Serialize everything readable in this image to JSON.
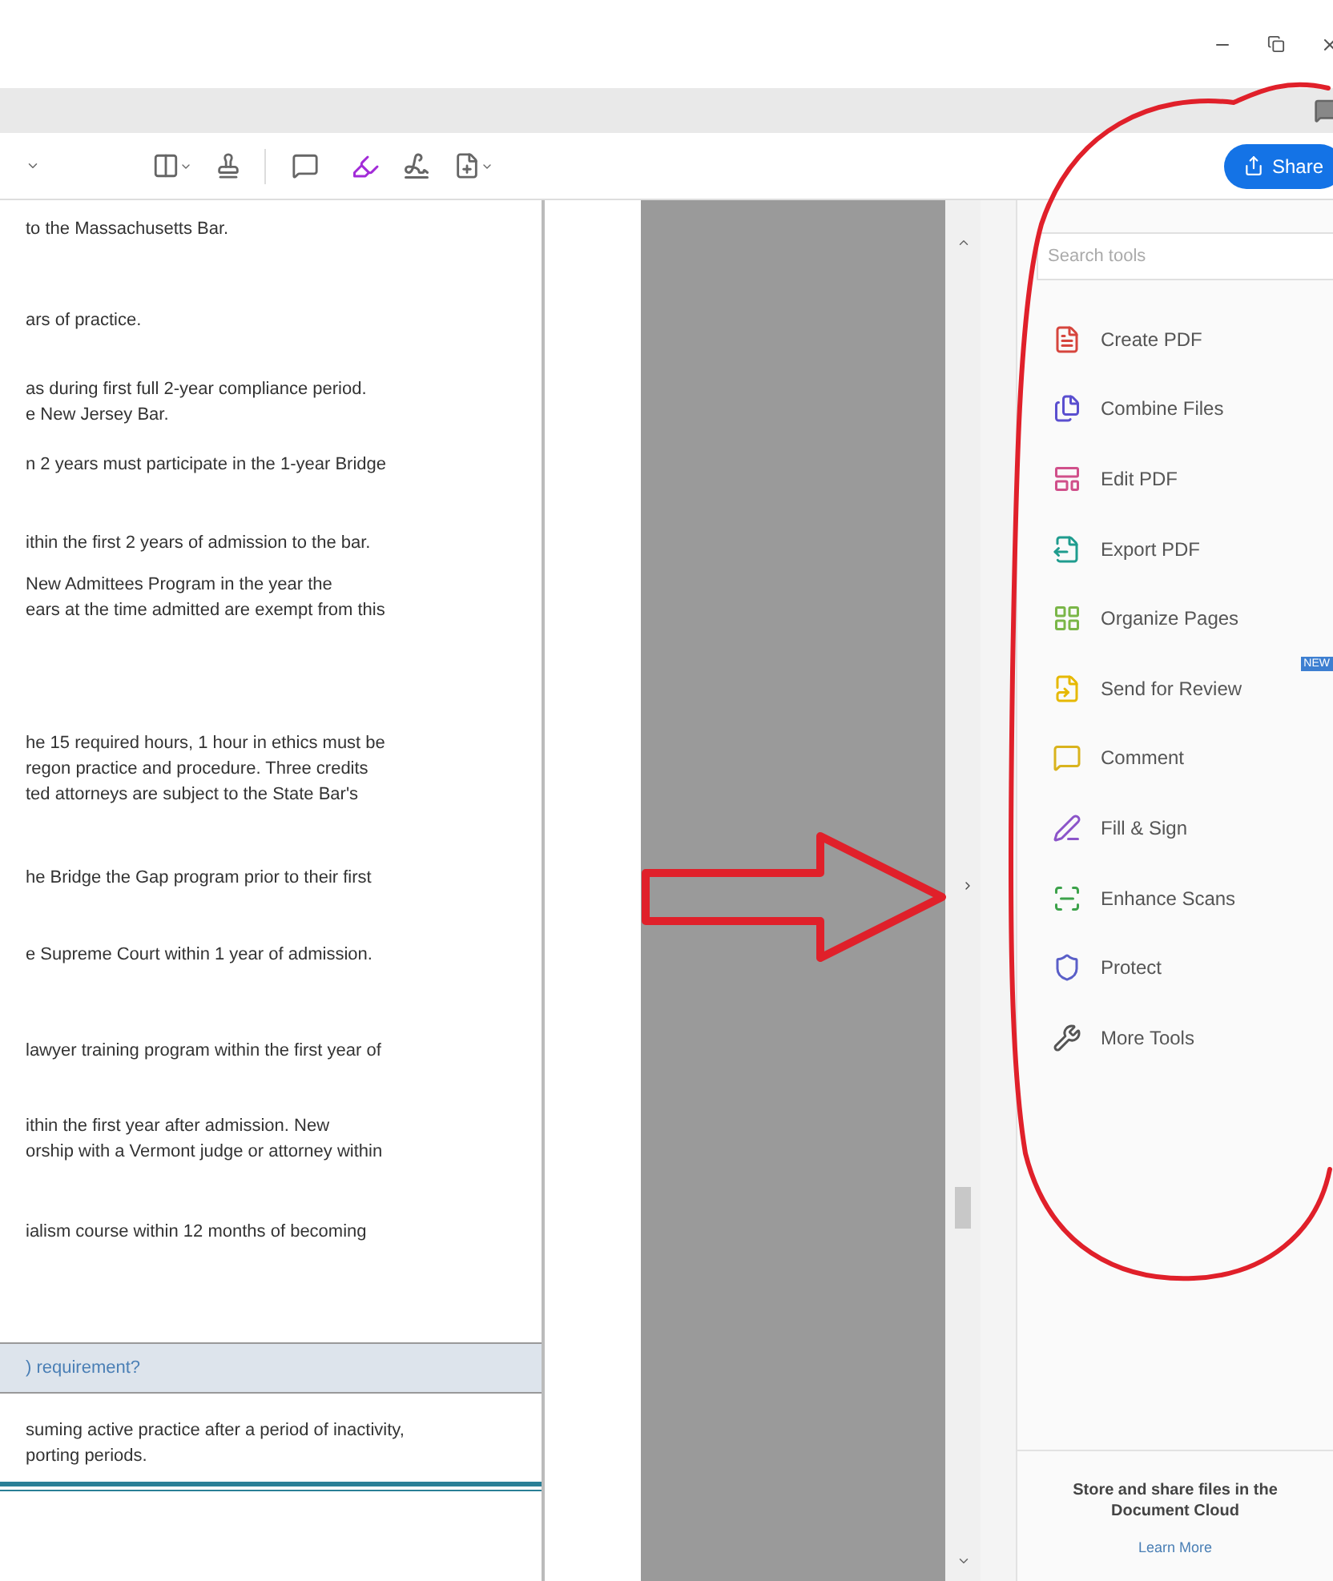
{
  "toolbar": {
    "share_button": "Share"
  },
  "document": {
    "paragraphs": [
      {
        "lines": [
          "to the Massachusetts Bar."
        ]
      },
      {
        "lines": [
          "ars of practice."
        ]
      },
      {
        "lines": [
          "as during first full 2-year compliance period.",
          "e New Jersey Bar."
        ]
      },
      {
        "lines": [
          "n 2 years must participate in the 1-year Bridge"
        ]
      },
      {
        "lines": [
          "ithin the first 2 years of admission to the bar."
        ]
      },
      {
        "lines": [
          "New Admittees Program in the year the",
          "ears at the time admitted are exempt from this"
        ]
      },
      {
        "lines": [
          "he 15 required hours, 1 hour in ethics must be",
          "regon practice and procedure. Three credits",
          "ted attorneys are subject to the State Bar's"
        ]
      },
      {
        "lines": [
          "he Bridge the Gap program prior to their first"
        ]
      },
      {
        "lines": [
          "e Supreme Court within 1 year of admission."
        ]
      },
      {
        "lines": [
          "lawyer training program within the first year of"
        ]
      },
      {
        "lines": [
          "ithin the first year after admission. New",
          "orship with a Vermont judge or attorney within"
        ]
      },
      {
        "lines": [
          "ialism course within 12 months of becoming"
        ]
      }
    ],
    "section_header": ") requirement?",
    "after_lines": [
      "suming active practice after a period of inactivity,",
      "porting periods."
    ]
  },
  "tools_panel": {
    "search": {
      "placeholder": "Search tools"
    },
    "tools": [
      {
        "label": "Create PDF"
      },
      {
        "label": "Combine Files"
      },
      {
        "label": "Edit PDF"
      },
      {
        "label": "Export PDF"
      },
      {
        "label": "Organize Pages"
      },
      {
        "label": "Send for Review",
        "badge": "NEW"
      },
      {
        "label": "Comment"
      },
      {
        "label": "Fill & Sign"
      },
      {
        "label": "Enhance Scans"
      },
      {
        "label": "Protect"
      },
      {
        "label": "More Tools"
      }
    ],
    "footer": {
      "text": "Store and share files in the Document Cloud",
      "link": "Learn More"
    }
  }
}
